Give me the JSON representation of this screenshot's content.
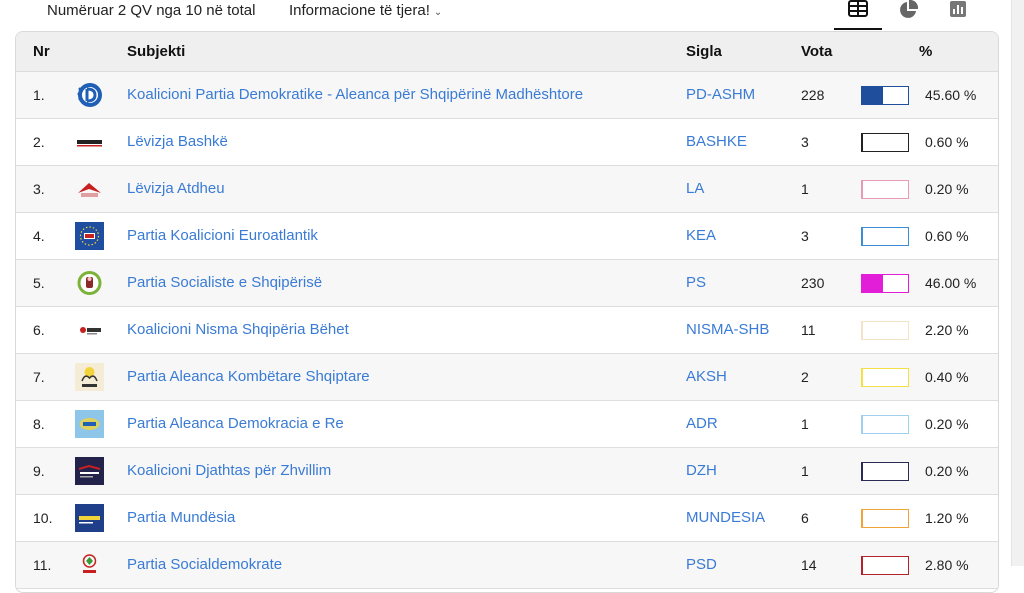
{
  "topbar": {
    "count_text": "Numëruar 2 QV nga 10 në total",
    "info_label": "Informacione të tjera!",
    "views": [
      {
        "name": "table-view",
        "active": true
      },
      {
        "name": "pie-view",
        "active": false
      },
      {
        "name": "bar-view",
        "active": false
      }
    ]
  },
  "table": {
    "headers": {
      "nr": "Nr",
      "subjekti": "Subjekti",
      "sigla": "Sigla",
      "vota": "Vota",
      "pct": "%"
    },
    "rows": [
      {
        "nr": "1.",
        "name": "Koalicioni Partia Demokratike - Aleanca për Shqipërinë Madhështore",
        "sigla": "PD-ASHM",
        "vota": "228",
        "pct": "45.60 %",
        "pct_value": 45.6,
        "color": "#1f4e9c",
        "logo": "pd-logo"
      },
      {
        "nr": "2.",
        "name": "Lëvizja Bashkë",
        "sigla": "BASHKE",
        "vota": "3",
        "pct": "0.60 %",
        "pct_value": 0.6,
        "color": "#222222",
        "logo": "bashke-logo"
      },
      {
        "nr": "3.",
        "name": "Lëvizja Atdheu",
        "sigla": "LA",
        "vota": "1",
        "pct": "0.20 %",
        "pct_value": 0.2,
        "color": "#e89ab8",
        "logo": "la-logo"
      },
      {
        "nr": "4.",
        "name": "Partia Koalicioni Euroatlantik",
        "sigla": "KEA",
        "vota": "3",
        "pct": "0.60 %",
        "pct_value": 0.6,
        "color": "#3b8ed6",
        "logo": "kea-logo"
      },
      {
        "nr": "5.",
        "name": "Partia Socialiste e Shqipërisë",
        "sigla": "PS",
        "vota": "230",
        "pct": "46.00 %",
        "pct_value": 46.0,
        "color": "#e21ed8",
        "logo": "ps-logo"
      },
      {
        "nr": "6.",
        "name": "Koalicioni Nisma Shqipëria Bëhet",
        "sigla": "NISMA-SHB",
        "vota": "11",
        "pct": "2.20 %",
        "pct_value": 2.2,
        "color": "#f2e3c9",
        "logo": "nisma-logo"
      },
      {
        "nr": "7.",
        "name": "Partia Aleanca Kombëtare Shqiptare",
        "sigla": "AKSH",
        "vota": "2",
        "pct": "0.40 %",
        "pct_value": 0.4,
        "color": "#f2e046",
        "logo": "aksh-logo"
      },
      {
        "nr": "8.",
        "name": "Partia Aleanca Demokracia e Re",
        "sigla": "ADR",
        "vota": "1",
        "pct": "0.20 %",
        "pct_value": 0.2,
        "color": "#9fd0ee",
        "logo": "adr-logo"
      },
      {
        "nr": "9.",
        "name": "Koalicioni Djathtas për Zhvillim",
        "sigla": "DZH",
        "vota": "1",
        "pct": "0.20 %",
        "pct_value": 0.2,
        "color": "#2a2a55",
        "logo": "dzh-logo"
      },
      {
        "nr": "10.",
        "name": "Partia Mundësia",
        "sigla": "MUNDESIA",
        "vota": "6",
        "pct": "1.20 %",
        "pct_value": 1.2,
        "color": "#f0a43c",
        "logo": "mundesia-logo"
      },
      {
        "nr": "11.",
        "name": "Partia Socialdemokrate",
        "sigla": "PSD",
        "vota": "14",
        "pct": "2.80 %",
        "pct_value": 2.8,
        "color": "#b4232a",
        "logo": "psd-logo"
      }
    ]
  }
}
